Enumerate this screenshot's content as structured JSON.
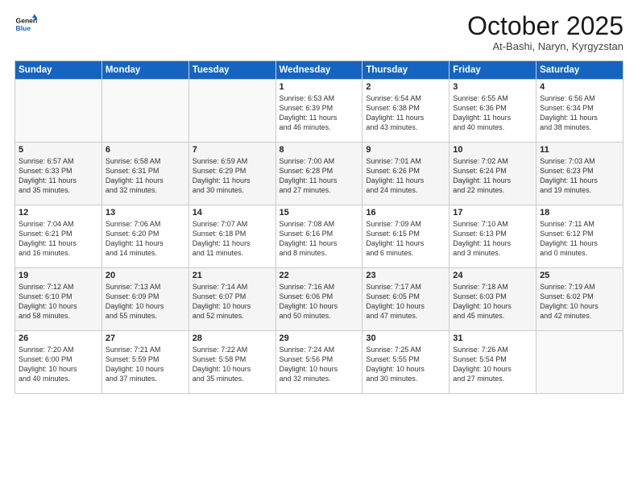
{
  "logo": {
    "line1": "General",
    "line2": "Blue"
  },
  "title": "October 2025",
  "location": "At-Bashi, Naryn, Kyrgyzstan",
  "weekdays": [
    "Sunday",
    "Monday",
    "Tuesday",
    "Wednesday",
    "Thursday",
    "Friday",
    "Saturday"
  ],
  "weeks": [
    [
      {
        "day": "",
        "info": ""
      },
      {
        "day": "",
        "info": ""
      },
      {
        "day": "",
        "info": ""
      },
      {
        "day": "1",
        "info": "Sunrise: 6:53 AM\nSunset: 6:39 PM\nDaylight: 11 hours\nand 46 minutes."
      },
      {
        "day": "2",
        "info": "Sunrise: 6:54 AM\nSunset: 6:38 PM\nDaylight: 11 hours\nand 43 minutes."
      },
      {
        "day": "3",
        "info": "Sunrise: 6:55 AM\nSunset: 6:36 PM\nDaylight: 11 hours\nand 40 minutes."
      },
      {
        "day": "4",
        "info": "Sunrise: 6:56 AM\nSunset: 6:34 PM\nDaylight: 11 hours\nand 38 minutes."
      }
    ],
    [
      {
        "day": "5",
        "info": "Sunrise: 6:57 AM\nSunset: 6:33 PM\nDaylight: 11 hours\nand 35 minutes."
      },
      {
        "day": "6",
        "info": "Sunrise: 6:58 AM\nSunset: 6:31 PM\nDaylight: 11 hours\nand 32 minutes."
      },
      {
        "day": "7",
        "info": "Sunrise: 6:59 AM\nSunset: 6:29 PM\nDaylight: 11 hours\nand 30 minutes."
      },
      {
        "day": "8",
        "info": "Sunrise: 7:00 AM\nSunset: 6:28 PM\nDaylight: 11 hours\nand 27 minutes."
      },
      {
        "day": "9",
        "info": "Sunrise: 7:01 AM\nSunset: 6:26 PM\nDaylight: 11 hours\nand 24 minutes."
      },
      {
        "day": "10",
        "info": "Sunrise: 7:02 AM\nSunset: 6:24 PM\nDaylight: 11 hours\nand 22 minutes."
      },
      {
        "day": "11",
        "info": "Sunrise: 7:03 AM\nSunset: 6:23 PM\nDaylight: 11 hours\nand 19 minutes."
      }
    ],
    [
      {
        "day": "12",
        "info": "Sunrise: 7:04 AM\nSunset: 6:21 PM\nDaylight: 11 hours\nand 16 minutes."
      },
      {
        "day": "13",
        "info": "Sunrise: 7:06 AM\nSunset: 6:20 PM\nDaylight: 11 hours\nand 14 minutes."
      },
      {
        "day": "14",
        "info": "Sunrise: 7:07 AM\nSunset: 6:18 PM\nDaylight: 11 hours\nand 11 minutes."
      },
      {
        "day": "15",
        "info": "Sunrise: 7:08 AM\nSunset: 6:16 PM\nDaylight: 11 hours\nand 8 minutes."
      },
      {
        "day": "16",
        "info": "Sunrise: 7:09 AM\nSunset: 6:15 PM\nDaylight: 11 hours\nand 6 minutes."
      },
      {
        "day": "17",
        "info": "Sunrise: 7:10 AM\nSunset: 6:13 PM\nDaylight: 11 hours\nand 3 minutes."
      },
      {
        "day": "18",
        "info": "Sunrise: 7:11 AM\nSunset: 6:12 PM\nDaylight: 11 hours\nand 0 minutes."
      }
    ],
    [
      {
        "day": "19",
        "info": "Sunrise: 7:12 AM\nSunset: 6:10 PM\nDaylight: 10 hours\nand 58 minutes."
      },
      {
        "day": "20",
        "info": "Sunrise: 7:13 AM\nSunset: 6:09 PM\nDaylight: 10 hours\nand 55 minutes."
      },
      {
        "day": "21",
        "info": "Sunrise: 7:14 AM\nSunset: 6:07 PM\nDaylight: 10 hours\nand 52 minutes."
      },
      {
        "day": "22",
        "info": "Sunrise: 7:16 AM\nSunset: 6:06 PM\nDaylight: 10 hours\nand 50 minutes."
      },
      {
        "day": "23",
        "info": "Sunrise: 7:17 AM\nSunset: 6:05 PM\nDaylight: 10 hours\nand 47 minutes."
      },
      {
        "day": "24",
        "info": "Sunrise: 7:18 AM\nSunset: 6:03 PM\nDaylight: 10 hours\nand 45 minutes."
      },
      {
        "day": "25",
        "info": "Sunrise: 7:19 AM\nSunset: 6:02 PM\nDaylight: 10 hours\nand 42 minutes."
      }
    ],
    [
      {
        "day": "26",
        "info": "Sunrise: 7:20 AM\nSunset: 6:00 PM\nDaylight: 10 hours\nand 40 minutes."
      },
      {
        "day": "27",
        "info": "Sunrise: 7:21 AM\nSunset: 5:59 PM\nDaylight: 10 hours\nand 37 minutes."
      },
      {
        "day": "28",
        "info": "Sunrise: 7:22 AM\nSunset: 5:58 PM\nDaylight: 10 hours\nand 35 minutes."
      },
      {
        "day": "29",
        "info": "Sunrise: 7:24 AM\nSunset: 5:56 PM\nDaylight: 10 hours\nand 32 minutes."
      },
      {
        "day": "30",
        "info": "Sunrise: 7:25 AM\nSunset: 5:55 PM\nDaylight: 10 hours\nand 30 minutes."
      },
      {
        "day": "31",
        "info": "Sunrise: 7:26 AM\nSunset: 5:54 PM\nDaylight: 10 hours\nand 27 minutes."
      },
      {
        "day": "",
        "info": ""
      }
    ]
  ]
}
